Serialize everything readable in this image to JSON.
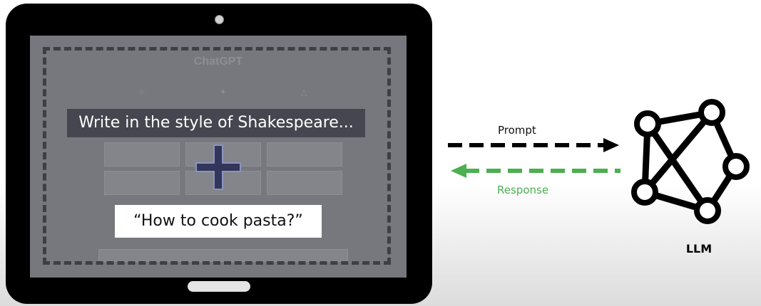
{
  "tablet": {
    "screen_title": "ChatGPT",
    "prompt_text": "Write in the style of Shakespeare...",
    "question_text": "“How to cook pasta?”"
  },
  "arrows": {
    "prompt_label": "Prompt",
    "response_label": "Response",
    "prompt_color": "#000000",
    "response_color": "#4caf50"
  },
  "llm": {
    "label": "LLM"
  },
  "colors": {
    "screen": "#77787d",
    "prompt_box": "#45464f",
    "plus_fill": "#34355a",
    "plus_stroke": "#8a95c0"
  }
}
